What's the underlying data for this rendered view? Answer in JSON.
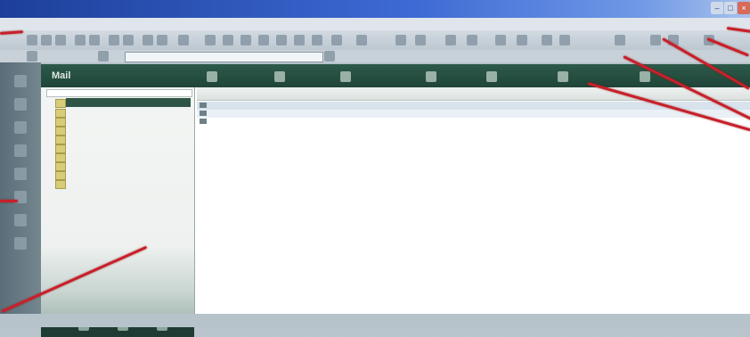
{
  "window": {
    "title": ""
  },
  "menu": {
    "items": [
      "",
      "",
      "",
      "",
      "",
      ""
    ]
  },
  "address": {
    "value": ""
  },
  "mail": {
    "title": "Mail",
    "toolbar": [
      {
        "name": "new-button",
        "label": ""
      },
      {
        "name": "reply-button",
        "label": ""
      },
      {
        "name": "forward-button",
        "label": ""
      },
      {
        "name": "delete-button",
        "label": ""
      },
      {
        "name": "send-receive-button",
        "label": ""
      },
      {
        "name": "tools-button",
        "label": ""
      }
    ]
  },
  "folders": {
    "items": [
      "",
      "",
      "",
      "",
      "",
      "",
      "",
      "",
      "",
      ""
    ]
  },
  "list": {
    "columns": [
      "",
      "",
      "",
      "",
      ""
    ],
    "rows": [
      {
        "from": "",
        "date": "",
        "size": "",
        "subject": ""
      },
      {
        "from": "",
        "date": "",
        "size": "",
        "subject": ""
      },
      {
        "from": "",
        "date": "",
        "size": "",
        "subject": ""
      }
    ]
  },
  "colors": {
    "titlebar": "#1d3f9a",
    "mail_header": "#2d5a4a",
    "selected_folder": "#2e5545",
    "annotation": "#c8202a"
  }
}
